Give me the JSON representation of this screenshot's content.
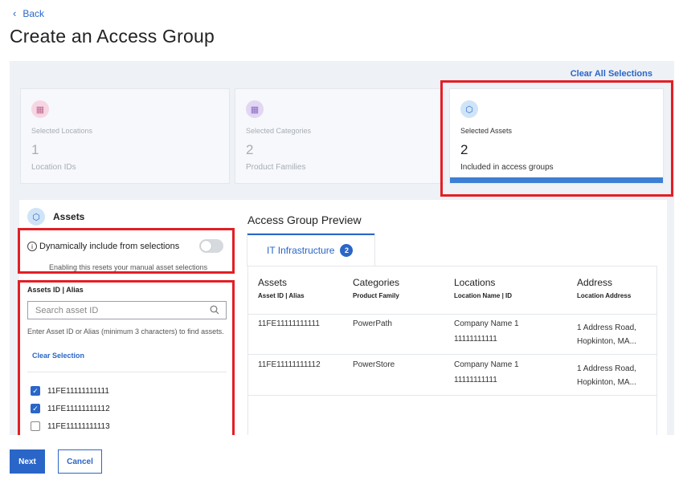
{
  "header": {
    "back_label": "Back",
    "title": "Create an Access Group"
  },
  "clear_all_label": "Clear All Selections",
  "summary_cards": [
    {
      "label": "Selected Locations",
      "value": "1",
      "sublabel": "Location IDs",
      "icon": "building-icon",
      "color": "#f7d6e4"
    },
    {
      "label": "Selected Categories",
      "value": "2",
      "sublabel": "Product Families",
      "icon": "category-icon",
      "color": "#e2d7f3"
    },
    {
      "label": "Selected Assets",
      "value": "2",
      "sublabel": "Included in access groups",
      "icon": "cube-icon",
      "color": "#cfe4f7"
    }
  ],
  "assets": {
    "title": "Assets",
    "dynamic_label": "Dynamically include from selections",
    "dynamic_note": "Enabling this resets your manual asset selections",
    "dynamic_on": false,
    "field_label": "Assets ID | Alias",
    "search_placeholder": "Search asset ID",
    "hint": "Enter Asset ID or Alias (minimum 3 characters) to find assets.",
    "clear_selection": "Clear Selection",
    "items": [
      {
        "id": "11FE11111111111",
        "checked": true
      },
      {
        "id": "11FE11111111112",
        "checked": true
      },
      {
        "id": "11FE11111111113",
        "checked": false
      }
    ]
  },
  "preview": {
    "title": "Access Group Preview",
    "tab_label": "IT Infrastructure",
    "tab_count": "2",
    "columns": [
      {
        "title": "Assets",
        "sub": "Asset ID | Alias"
      },
      {
        "title": "Categories",
        "sub": "Product Family"
      },
      {
        "title": "Locations",
        "sub": "Location Name | ID"
      },
      {
        "title": "Address",
        "sub": "Location Address"
      }
    ],
    "rows": [
      {
        "asset": "11FE11111111111",
        "category": "PowerPath",
        "location_name": "Company Name 1",
        "location_id": "11111111111",
        "address1": "1 Address Road,",
        "address2": "Hopkinton, MA..."
      },
      {
        "asset": "11FE11111111112",
        "category": "PowerStore",
        "location_name": "Company Name 1",
        "location_id": "11111111111",
        "address1": "1 Address Road,",
        "address2": "Hopkinton, MA..."
      }
    ]
  },
  "footer": {
    "next_label": "Next",
    "cancel_label": "Cancel"
  },
  "colors": {
    "accent": "#2a66c8",
    "highlight": "#e21f26"
  }
}
